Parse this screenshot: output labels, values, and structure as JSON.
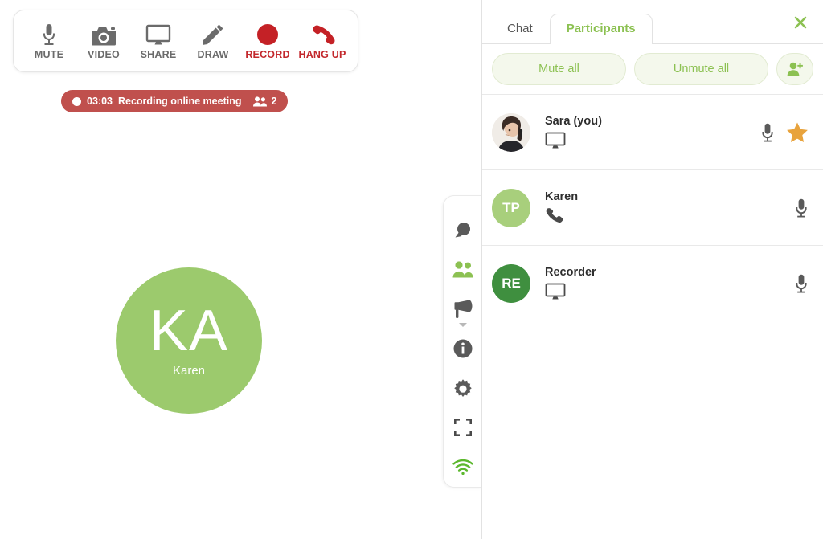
{
  "toolbar": {
    "buttons": [
      {
        "label": "MUTE",
        "icon": "microphone-icon",
        "style": "normal"
      },
      {
        "label": "VIDEO",
        "icon": "camera-icon",
        "style": "normal"
      },
      {
        "label": "SHARE",
        "icon": "monitor-icon",
        "style": "normal"
      },
      {
        "label": "DRAW",
        "icon": "pencil-icon",
        "style": "normal"
      },
      {
        "label": "RECORD",
        "icon": "record-dot-icon",
        "style": "danger"
      },
      {
        "label": "HANG UP",
        "icon": "hang-up-icon",
        "style": "danger"
      }
    ]
  },
  "recording_bar": {
    "timer": "03:03",
    "text": "Recording online meeting",
    "participant_count": "2",
    "color": "#c0504d"
  },
  "stage": {
    "active_speaker": {
      "initials": "KA",
      "name": "Karen",
      "color": "#9cca6d"
    }
  },
  "rail": {
    "items": [
      {
        "icon": "chat-bubble-icon",
        "active": false
      },
      {
        "icon": "participants-icon",
        "active": true
      },
      {
        "icon": "megaphone-icon",
        "active": false,
        "has_caret": true
      },
      {
        "icon": "info-icon",
        "active": false
      },
      {
        "icon": "gear-icon",
        "active": false
      },
      {
        "icon": "fullscreen-icon",
        "active": false
      },
      {
        "icon": "wifi-icon",
        "active": true
      }
    ]
  },
  "panel": {
    "tabs": [
      {
        "label": "Chat",
        "active": false
      },
      {
        "label": "Participants",
        "active": true
      }
    ],
    "close_icon": "close-icon",
    "actions": {
      "mute_all": "Mute all",
      "unmute_all": "Unmute all",
      "add_participant_icon": "add-user-icon"
    },
    "participants": [
      {
        "name": "Sara (you)",
        "avatar_type": "photo",
        "initials": "",
        "avatar_color": "#efe9e3",
        "device": "monitor-icon",
        "mic": "microphone-icon",
        "starred": true,
        "star_color": "#e8a33d"
      },
      {
        "name": "Karen",
        "avatar_type": "initials",
        "initials": "TP",
        "avatar_color": "#a8cf7c",
        "device": "phone-icon",
        "mic": "microphone-icon",
        "starred": false,
        "star_color": "#e8a33d"
      },
      {
        "name": "Recorder",
        "avatar_type": "initials",
        "initials": "RE",
        "avatar_color": "#3f8f3f",
        "device": "monitor-icon",
        "mic": "microphone-icon",
        "starred": false,
        "star_color": "#e8a33d"
      }
    ]
  },
  "colors": {
    "brand_green": "#8cc152",
    "avatar_green": "#9cca6d",
    "danger_red": "#c3282c",
    "recording_red": "#c0504d",
    "star_orange": "#e8a33d"
  }
}
